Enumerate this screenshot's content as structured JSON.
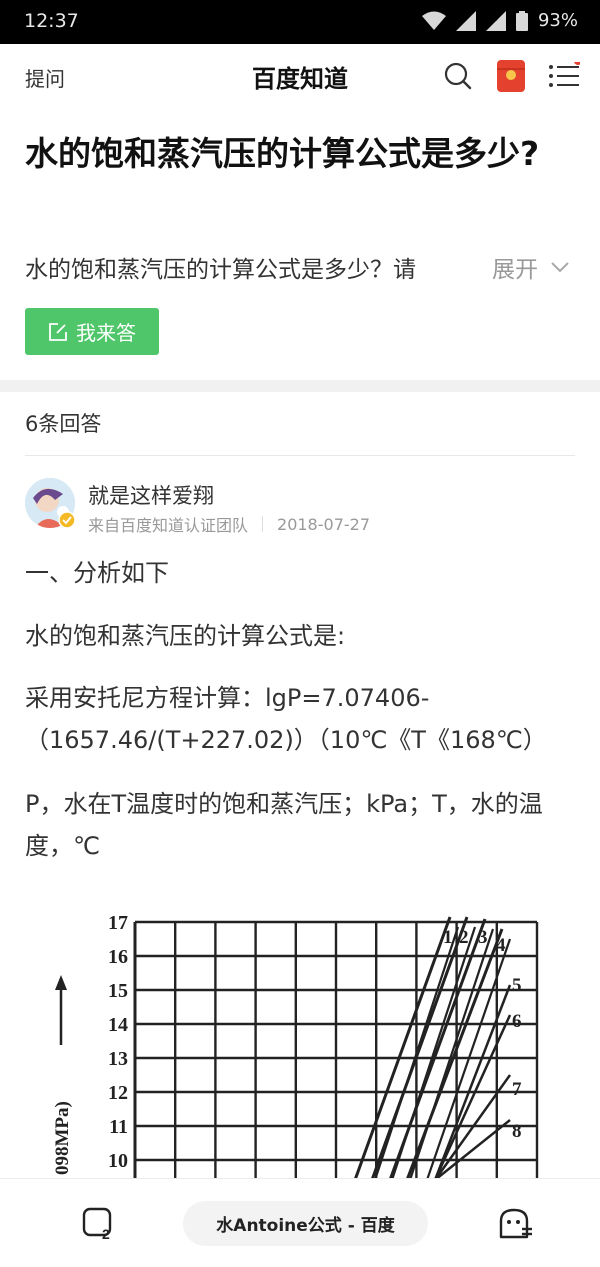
{
  "status": {
    "time": "12:37",
    "battery": "93%"
  },
  "nav": {
    "ask": "提问",
    "brand": "百度知道"
  },
  "question": {
    "title": "水的饱和蒸汽压的计算公式是多少?",
    "desc": "水的饱和蒸汽压的计算公式是多少？请",
    "expand": "展开"
  },
  "answer_button": "我来答",
  "answers_count": "6条回答",
  "answer": {
    "author": "就是这样爱翔",
    "source": "来自百度知道认证团队",
    "date": "2018-07-27",
    "p1": "一、分析如下",
    "p2": "水的饱和蒸汽压的计算公式是:",
    "p3": "采用安托尼方程计算：lgP=7.07406-（1657.46/(T+227.02)）（10℃《T《168℃）",
    "p4": "P，水在T温度时的饱和蒸汽压；kPa；T，水的温度，℃"
  },
  "figure": {
    "y_ticks": [
      "17",
      "16",
      "15",
      "14",
      "13",
      "12",
      "11",
      "10"
    ],
    "y_label": "098MPa)",
    "curve_labels": [
      "1",
      "2",
      "3",
      "4",
      "5",
      "6",
      "7",
      "8"
    ]
  },
  "bottom": {
    "search_pill": "水Antoine公式 - 百度"
  },
  "colors": {
    "accent_green": "#4fc66a",
    "red": "#e5412f"
  }
}
